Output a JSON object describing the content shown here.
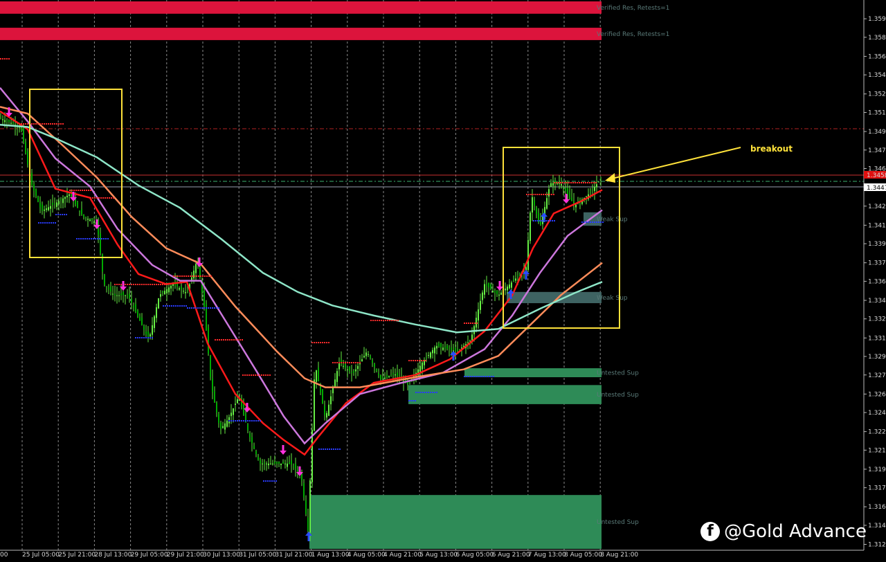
{
  "chart_data": {
    "type": "candlestick",
    "price_range": [
      1.3124,
      1.3612
    ],
    "price_ticks": [
      "1.35965",
      "1.35800",
      "1.35630",
      "1.35465",
      "1.35295",
      "1.35130",
      "1.34960",
      "1.34795",
      "1.34630",
      "1.34295",
      "1.34125",
      "1.33960",
      "1.33790",
      "1.33625",
      "1.33455",
      "1.33290",
      "1.33120",
      "1.32955",
      "1.32790",
      "1.32620",
      "1.32455",
      "1.32285",
      "1.32120",
      "1.31950",
      "1.31785",
      "1.31615",
      "1.31450",
      "1.31280"
    ],
    "current_price_label": "1.34476",
    "red_price_label": "1.34588",
    "time_labels": [
      "25 Jul 05:00",
      "25 Jul 21:00",
      "28 Jul 13:00",
      "29 Jul 05:00",
      "29 Jul 21:00",
      "30 Jul 13:00",
      "31 Jul 05:00",
      "31 Jul 21:00",
      "1 Aug 13:00",
      "4 Aug 05:00",
      "4 Aug 21:00",
      "5 Aug 13:00",
      "6 Aug 05:00",
      "6 Aug 21:00",
      "7 Aug 13:00",
      "8 Aug 05:00",
      "8 Aug 21:00"
    ],
    "first_time_fragment": "00",
    "zones": [
      {
        "kind": "resistance",
        "price_top": 1.3612,
        "price_bottom": 1.3601,
        "color": "#dc143c",
        "label": "Verified Res, Retests=1"
      },
      {
        "kind": "resistance",
        "price_top": 1.35885,
        "price_bottom": 1.35775,
        "color": "#dc143c",
        "label": "Verified Res, Retests=1"
      },
      {
        "kind": "weak_support",
        "price_top": 1.3424,
        "price_bottom": 1.3412,
        "color": "#3e6362",
        "label": "Weak Sup"
      },
      {
        "kind": "weak_support",
        "price_top": 1.3353,
        "price_bottom": 1.3343,
        "color": "#3e6362",
        "label": "Weak Sup"
      },
      {
        "kind": "untested_support",
        "price_top": 1.3285,
        "price_bottom": 1.3277,
        "color": "#2e8b57",
        "label": "Untested Sup"
      },
      {
        "kind": "untested_support",
        "price_top": 1.327,
        "price_bottom": 1.3253,
        "color": "#2e8b57",
        "label": "Untested Sup"
      },
      {
        "kind": "untested_support",
        "price_top": 1.3172,
        "price_bottom": 1.3124,
        "color": "#2e8b57",
        "label": "Untested Sup"
      }
    ],
    "series": [
      {
        "color": "#ff1a1a",
        "points": [
          [
            0,
            1.3514
          ],
          [
            40,
            1.3498
          ],
          [
            80,
            1.3445
          ],
          [
            130,
            1.3437
          ],
          [
            170,
            1.3395
          ],
          [
            200,
            1.3369
          ],
          [
            240,
            1.336
          ],
          [
            270,
            1.3362
          ],
          [
            300,
            1.3307
          ],
          [
            340,
            1.3262
          ],
          [
            380,
            1.3236
          ],
          [
            410,
            1.3221
          ],
          [
            440,
            1.3208
          ],
          [
            460,
            1.3224
          ],
          [
            500,
            1.3254
          ],
          [
            540,
            1.3272
          ],
          [
            600,
            1.3279
          ],
          [
            650,
            1.3293
          ],
          [
            700,
            1.3318
          ],
          [
            740,
            1.335
          ],
          [
            770,
            1.3392
          ],
          [
            800,
            1.3423
          ],
          [
            840,
            1.3434
          ],
          [
            870,
            1.3444
          ]
        ]
      },
      {
        "color": "#cc77dd",
        "points": [
          [
            0,
            1.3535
          ],
          [
            40,
            1.3505
          ],
          [
            80,
            1.3472
          ],
          [
            130,
            1.3447
          ],
          [
            170,
            1.3409
          ],
          [
            220,
            1.3377
          ],
          [
            260,
            1.3363
          ],
          [
            290,
            1.3363
          ],
          [
            330,
            1.3323
          ],
          [
            370,
            1.3283
          ],
          [
            410,
            1.3242
          ],
          [
            440,
            1.3218
          ],
          [
            470,
            1.3236
          ],
          [
            520,
            1.3262
          ],
          [
            580,
            1.3272
          ],
          [
            640,
            1.3281
          ],
          [
            700,
            1.3302
          ],
          [
            740,
            1.3332
          ],
          [
            780,
            1.337
          ],
          [
            820,
            1.3403
          ],
          [
            870,
            1.3426
          ]
        ]
      },
      {
        "color": "#ff8c5a",
        "points": [
          [
            0,
            1.3518
          ],
          [
            40,
            1.3512
          ],
          [
            90,
            1.3484
          ],
          [
            140,
            1.3455
          ],
          [
            190,
            1.342
          ],
          [
            240,
            1.3392
          ],
          [
            290,
            1.3378
          ],
          [
            340,
            1.334
          ],
          [
            400,
            1.33
          ],
          [
            440,
            1.3276
          ],
          [
            470,
            1.3268
          ],
          [
            520,
            1.3268
          ],
          [
            600,
            1.3277
          ],
          [
            670,
            1.3284
          ],
          [
            720,
            1.3296
          ],
          [
            760,
            1.332
          ],
          [
            810,
            1.335
          ],
          [
            870,
            1.3379
          ]
        ]
      },
      {
        "color": "#8ee6c8",
        "points": [
          [
            0,
            1.3502
          ],
          [
            40,
            1.35
          ],
          [
            80,
            1.349
          ],
          [
            140,
            1.3473
          ],
          [
            200,
            1.3448
          ],
          [
            260,
            1.3428
          ],
          [
            320,
            1.34
          ],
          [
            380,
            1.337
          ],
          [
            430,
            1.3353
          ],
          [
            480,
            1.3341
          ],
          [
            540,
            1.3332
          ],
          [
            600,
            1.3324
          ],
          [
            660,
            1.3317
          ],
          [
            720,
            1.332
          ],
          [
            780,
            1.3338
          ],
          [
            830,
            1.3352
          ],
          [
            870,
            1.3362
          ]
        ]
      }
    ],
    "annotation": "breakout"
  },
  "watermark": {
    "handle": "@Gold Advance",
    "icon": "facebook-icon"
  }
}
